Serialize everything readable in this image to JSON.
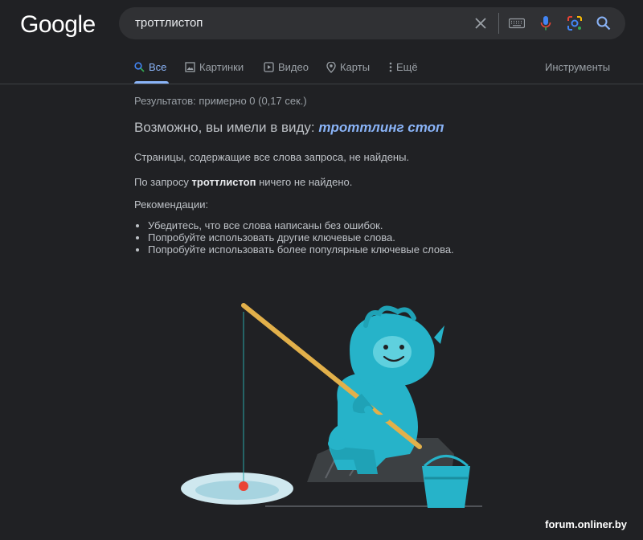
{
  "logo": "Google",
  "search": {
    "query": "троттлистоп"
  },
  "tabs": [
    {
      "label": "Все",
      "icon": "search-icon"
    },
    {
      "label": "Картинки",
      "icon": "image-icon"
    },
    {
      "label": "Видео",
      "icon": "play-icon"
    },
    {
      "label": "Карты",
      "icon": "map-pin-icon"
    },
    {
      "label": "Ещё",
      "icon": "more-vert-icon"
    }
  ],
  "tools_label": "Инструменты",
  "results": {
    "stats": "Результатов: примерно 0 (0,17 сек.)",
    "did_you_mean_prefix": "Возможно, вы имели в виду:",
    "did_you_mean_suggestion": "троттлинг стоп",
    "not_found_line": "Страницы, содержащие все слова запроса, не найдены.",
    "query_prefix": "По запросу",
    "query_bold": "троттлистоп",
    "query_suffix": "ничего не найдено.",
    "recommendations_title": "Рекомендации:",
    "recommendations": [
      "Убедитесь, что все слова написаны без ошибок.",
      "Попробуйте использовать другие ключевые слова.",
      "Попробуйте использовать более популярные ключевые слова."
    ]
  },
  "watermark": "forum.onliner.by",
  "colors": {
    "accent": "#8ab4f8",
    "background": "#202124",
    "search_bg": "#303134",
    "character": "#26b3c9"
  }
}
